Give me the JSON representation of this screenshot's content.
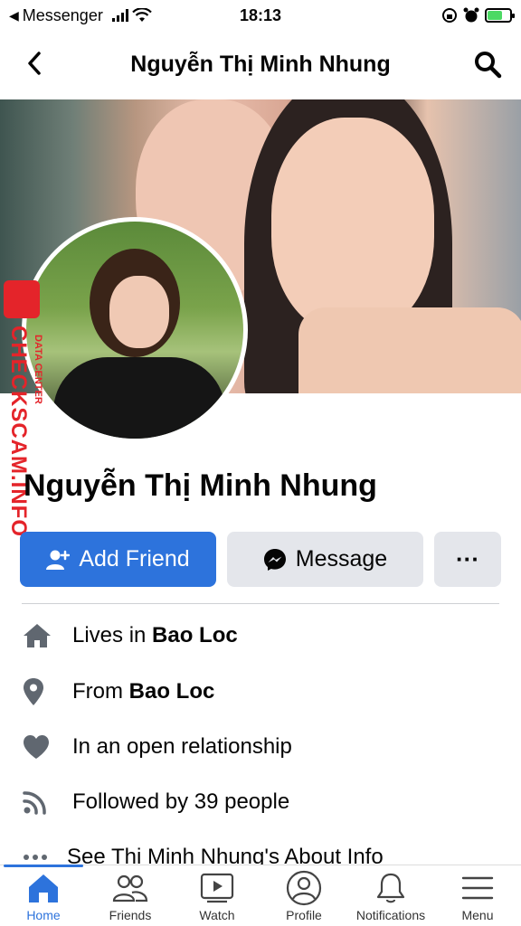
{
  "status_bar": {
    "back_app": "Messenger",
    "time": "18:13"
  },
  "header": {
    "title": "Nguyễn Thị Minh Nhung"
  },
  "profile": {
    "name": "Nguyễn Thị Minh Nhung"
  },
  "watermark": {
    "text": "CHECKSCAM.INFO",
    "subtext": "DATA CENTER"
  },
  "actions": {
    "add_friend": "Add Friend",
    "message": "Message",
    "more": "···"
  },
  "info": [
    {
      "prefix": "Lives in ",
      "bold": "Bao Loc",
      "icon": "home-icon"
    },
    {
      "prefix": "From ",
      "bold": "Bao Loc",
      "icon": "location-pin-icon"
    },
    {
      "prefix": "In an open relationship",
      "bold": "",
      "icon": "heart-icon"
    },
    {
      "prefix": "Followed by 39 people",
      "bold": "",
      "icon": "rss-icon"
    },
    {
      "prefix": "See Thi Minh Nhung's About Info",
      "bold": "",
      "icon": "more-icon"
    }
  ],
  "tabs": [
    {
      "label": "Home",
      "icon": "home-icon",
      "active": true
    },
    {
      "label": "Friends",
      "icon": "friends-icon",
      "active": false
    },
    {
      "label": "Watch",
      "icon": "watch-icon",
      "active": false
    },
    {
      "label": "Profile",
      "icon": "profile-icon",
      "active": false
    },
    {
      "label": "Notifications",
      "icon": "bell-icon",
      "active": false
    },
    {
      "label": "Menu",
      "icon": "menu-icon",
      "active": false
    }
  ],
  "colors": {
    "accent": "#2d73dc",
    "button_gray": "#e4e6eb",
    "icon_gray": "#606770",
    "watermark_red": "#e4242a"
  }
}
